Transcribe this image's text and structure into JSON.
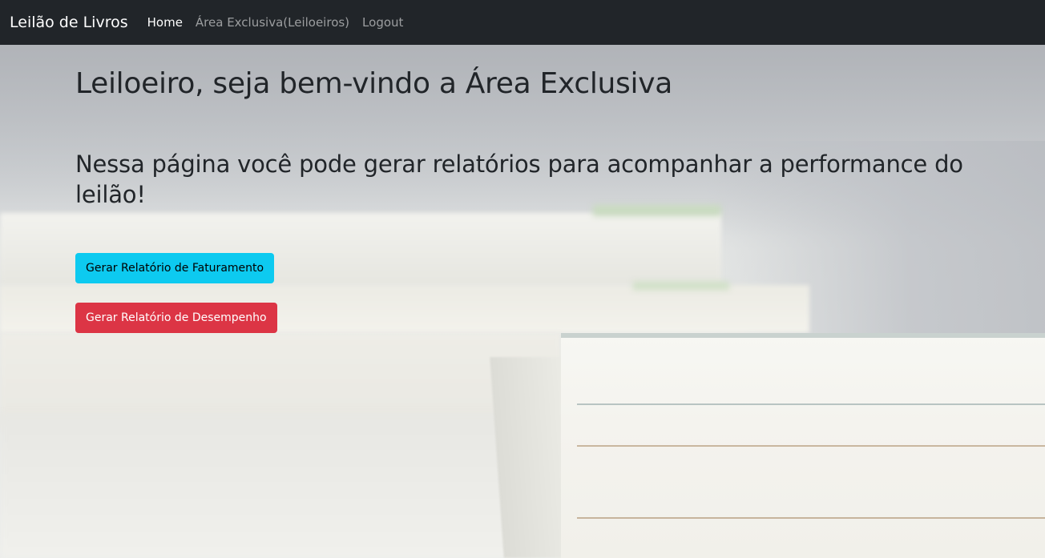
{
  "navbar": {
    "brand": "Leilão de Livros",
    "links": [
      {
        "label": "Home",
        "active": true
      },
      {
        "label": "Área Exclusiva(Leiloeiros)",
        "active": false
      },
      {
        "label": "Logout",
        "active": false
      }
    ]
  },
  "main": {
    "title": "Leiloeiro, seja bem-vindo a Área Exclusiva",
    "subtitle": "Nessa página você pode gerar relatórios para acompanhar a performance do leilão!",
    "buttons": {
      "billing_report": "Gerar Relatório de Faturamento",
      "performance_report": "Gerar Relatório de Desempenho"
    }
  },
  "colors": {
    "navbar_bg": "#212529",
    "info": "#0dcaf0",
    "danger": "#dc3545"
  }
}
